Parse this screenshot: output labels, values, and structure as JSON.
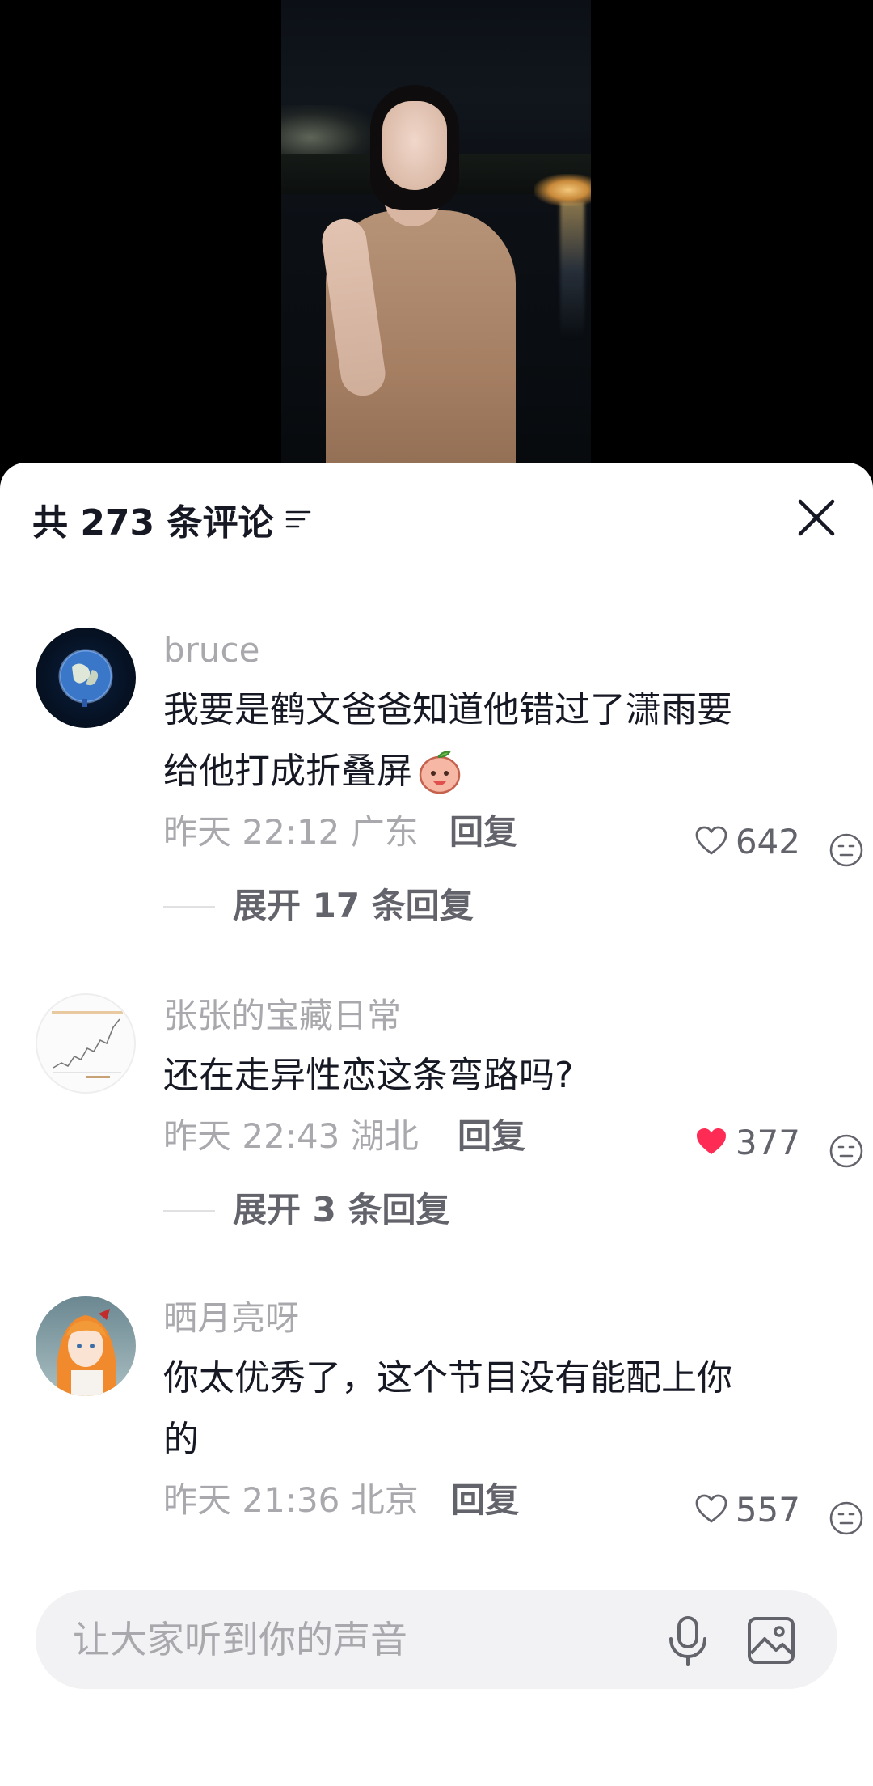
{
  "header": {
    "title": "共 273 条评论"
  },
  "comments": [
    {
      "username": "bruce",
      "text_line1": "我要是鹤文爸爸知道他错过了潇雨要",
      "text_line2": "给他打成折叠屏",
      "time_location": "昨天 22:12 广东",
      "reply_label": "回复",
      "likes": "642",
      "liked": false,
      "expand_label": "展开 17 条回复"
    },
    {
      "username": "张张的宝藏日常",
      "text_line1": "还在走异性恋这条弯路吗?",
      "time_location": "昨天 22:43 湖北",
      "reply_label": "回复",
      "likes": "377",
      "liked": true,
      "expand_label": "展开 3 条回复"
    },
    {
      "username": "晒月亮呀",
      "text_line1": "你太优秀了，这个节目没有能配上你",
      "text_line2": "的",
      "time_location": "昨天 21:36 北京",
      "reply_label": "回复",
      "likes": "557",
      "liked": false
    }
  ],
  "input": {
    "placeholder": "让大家听到你的声音"
  },
  "colors": {
    "like_active": "#fe2c55",
    "text_primary": "#161823",
    "text_secondary": "#a8a8ad"
  }
}
